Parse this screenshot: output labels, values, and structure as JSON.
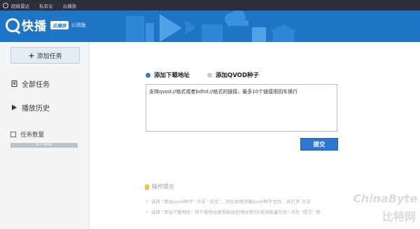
{
  "topnav": {
    "items": [
      "超级雷达",
      "私有云",
      "云播放"
    ]
  },
  "header": {
    "brand_name": "快播",
    "edition": "云播放",
    "beta": "公测版",
    "color": "#1f74c6"
  },
  "sidebar": {
    "add_task": "添加任务",
    "items": [
      {
        "label": "全部任务",
        "icon": "list-icon"
      },
      {
        "label": "播放历史",
        "icon": "play-history-icon"
      }
    ],
    "quota_label": "任务数量",
    "quota_text": "0 / 1000",
    "quota_fraction": 0
  },
  "main": {
    "radio_url": "添加下载地址",
    "radio_seed": "添加QVOD种子",
    "url_placeholder": "支持qvod://格式或者bdhd://格式的链接，最多10个链接用回车换行",
    "submit": "提交",
    "tips_title": "操作提示",
    "tips": [
      "选择 \"添加qvod种子\"   点击 \"浏览\"，浏览本地快播qvod种子文件，并打开   点击",
      "选择 \"添加下载地址\"   将下载地址复制粘贴到地址框内(支持批量任务)   点击 \"提交\" 即"
    ]
  },
  "watermark": {
    "line1": "ChinaByte",
    "line2": "比特网"
  },
  "colors": {
    "accent": "#2c78d0",
    "sidebar_bg": "#f4f5f7"
  }
}
